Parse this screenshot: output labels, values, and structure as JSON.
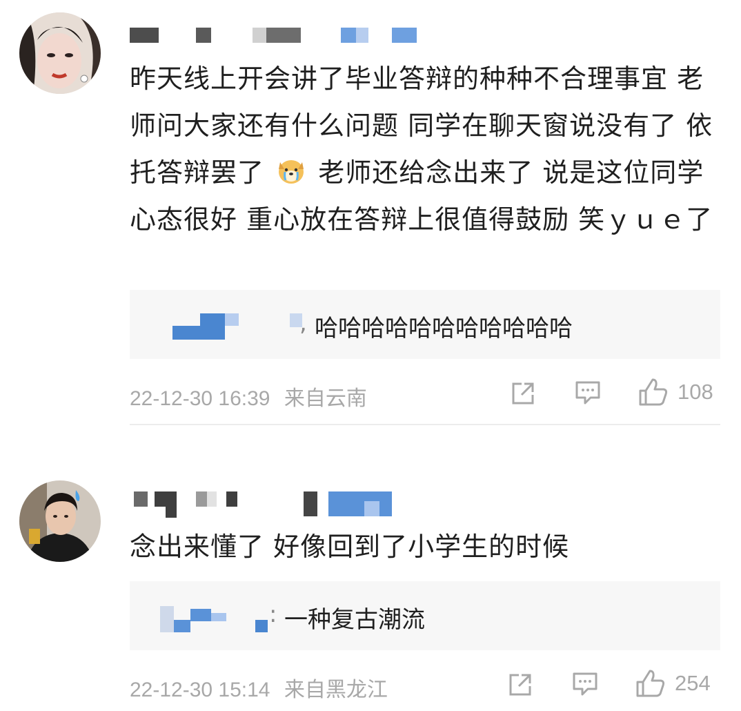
{
  "comments": [
    {
      "text": "昨天线上开会讲了毕业答辩的种种不合理事宜 老师问大家还有什么问题 同学在聊天窗说没有了 依托答辩罢了",
      "text_after_emoji": "老师还给念出来了 说是这位同学心态很好 重心放在答辩上很值得鼓励 笑ｙｕｅ了",
      "reply": "哈哈哈哈哈哈哈哈哈哈哈",
      "reply_prefix": ",",
      "timestamp": "22-12-30 16:39",
      "location": "来自云南",
      "likes": "108"
    },
    {
      "text": "念出来懂了 好像回到了小学生的时候",
      "reply": "一种复古潮流",
      "reply_prefix": ":",
      "timestamp": "22-12-30 15:14",
      "location": "来自黑龙江",
      "likes": "254"
    }
  ],
  "icons": {
    "share": "share-icon",
    "comment": "comment-icon",
    "like": "thumbs-up-icon",
    "emoji": "crying-dog-emoji"
  },
  "colors": {
    "meta": "#a8a8a8",
    "reply_bg": "#f7f7f7",
    "name_blur": "#5a92d8"
  }
}
